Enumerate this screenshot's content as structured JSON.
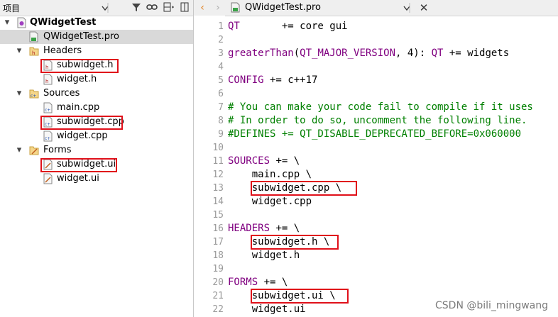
{
  "left_panel": {
    "title": "项目",
    "tree": [
      {
        "label": "QWidgetTest",
        "depth": 0,
        "arrow": "▼",
        "icon": "project-icon",
        "bold": true
      },
      {
        "label": "QWidgetTest.pro",
        "depth": 1,
        "arrow": "",
        "icon": "pro-file-icon",
        "selected": true
      },
      {
        "label": "Headers",
        "depth": 1,
        "arrow": "▼",
        "icon": "headers-folder-icon"
      },
      {
        "label": "subwidget.h",
        "depth": 2,
        "arrow": "",
        "icon": "h-file-icon",
        "highlighted": true
      },
      {
        "label": "widget.h",
        "depth": 2,
        "arrow": "",
        "icon": "h-file-icon"
      },
      {
        "label": "Sources",
        "depth": 1,
        "arrow": "▼",
        "icon": "sources-folder-icon"
      },
      {
        "label": "main.cpp",
        "depth": 2,
        "arrow": "",
        "icon": "cpp-file-icon"
      },
      {
        "label": "subwidget.cpp",
        "depth": 2,
        "arrow": "",
        "icon": "cpp-file-icon",
        "highlighted": true
      },
      {
        "label": "widget.cpp",
        "depth": 2,
        "arrow": "",
        "icon": "cpp-file-icon"
      },
      {
        "label": "Forms",
        "depth": 1,
        "arrow": "▼",
        "icon": "forms-folder-icon"
      },
      {
        "label": "subwidget.ui",
        "depth": 2,
        "arrow": "",
        "icon": "ui-file-icon",
        "highlighted": true
      },
      {
        "label": "widget.ui",
        "depth": 2,
        "arrow": "",
        "icon": "ui-file-icon"
      }
    ]
  },
  "editor": {
    "tab_title": "QWidgetTest.pro",
    "lines": [
      {
        "n": "1",
        "parts": [
          [
            "kw",
            "QT"
          ],
          [
            "pl",
            "       += core gui"
          ]
        ]
      },
      {
        "n": "2",
        "parts": []
      },
      {
        "n": "3",
        "parts": [
          [
            "kw",
            "greaterThan"
          ],
          [
            "pl",
            "("
          ],
          [
            "kw",
            "QT_MAJOR_VERSION"
          ],
          [
            "pl",
            ", 4): "
          ],
          [
            "kw",
            "QT"
          ],
          [
            "pl",
            " += widgets"
          ]
        ]
      },
      {
        "n": "4",
        "parts": []
      },
      {
        "n": "5",
        "parts": [
          [
            "kw",
            "CONFIG"
          ],
          [
            "pl",
            " += c++17"
          ]
        ]
      },
      {
        "n": "6",
        "parts": []
      },
      {
        "n": "7",
        "parts": [
          [
            "cm",
            "# You can make your code fail to compile if it uses"
          ]
        ]
      },
      {
        "n": "8",
        "parts": [
          [
            "cm",
            "# In order to do so, uncomment the following line."
          ]
        ]
      },
      {
        "n": "9",
        "parts": [
          [
            "cm",
            "#DEFINES += QT_DISABLE_DEPRECATED_BEFORE=0x060000"
          ]
        ]
      },
      {
        "n": "10",
        "parts": []
      },
      {
        "n": "11",
        "parts": [
          [
            "kw",
            "SOURCES"
          ],
          [
            "pl",
            " += \\"
          ]
        ]
      },
      {
        "n": "12",
        "parts": [
          [
            "pl",
            "    main.cpp \\"
          ]
        ]
      },
      {
        "n": "13",
        "parts": [
          [
            "pl",
            "    subwidget.cpp \\"
          ]
        ],
        "highlighted": true
      },
      {
        "n": "14",
        "parts": [
          [
            "pl",
            "    widget.cpp"
          ]
        ]
      },
      {
        "n": "15",
        "parts": []
      },
      {
        "n": "16",
        "parts": [
          [
            "kw",
            "HEADERS"
          ],
          [
            "pl",
            " += \\"
          ]
        ]
      },
      {
        "n": "17",
        "parts": [
          [
            "pl",
            "    subwidget.h \\"
          ]
        ],
        "highlighted": true
      },
      {
        "n": "18",
        "parts": [
          [
            "pl",
            "    widget.h"
          ]
        ]
      },
      {
        "n": "19",
        "parts": []
      },
      {
        "n": "20",
        "parts": [
          [
            "kw",
            "FORMS"
          ],
          [
            "pl",
            " += \\"
          ]
        ]
      },
      {
        "n": "21",
        "parts": [
          [
            "pl",
            "    subwidget.ui \\"
          ]
        ],
        "highlighted": true
      },
      {
        "n": "22",
        "parts": [
          [
            "pl",
            "    widget.ui"
          ]
        ]
      }
    ]
  },
  "watermark": "CSDN @bili_mingwang"
}
